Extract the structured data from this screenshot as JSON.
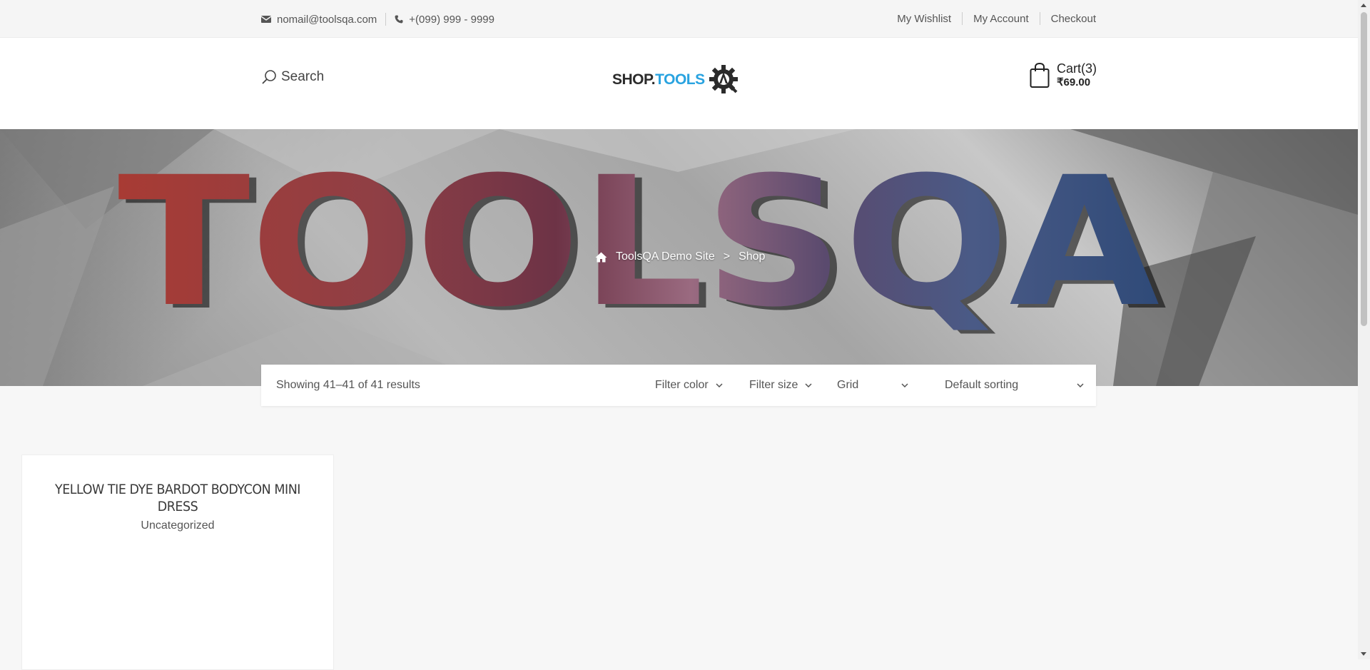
{
  "topbar": {
    "email": "nomail@toolsqa.com",
    "phone": "+(099) 999 - 9999",
    "links": [
      "My Wishlist",
      "My Account",
      "Checkout"
    ]
  },
  "header": {
    "search_label": "Search",
    "logo_shop": "SHOP.",
    "logo_tools": "TOOLS",
    "logo_badge": "QA",
    "cart_label": "Cart(3)",
    "cart_total": "₹69.00"
  },
  "hero": {
    "banner_text": "TOOLSQA",
    "breadcrumb_home": "ToolsQA Demo Site",
    "breadcrumb_sep": ">",
    "breadcrumb_current": "Shop"
  },
  "toolbar": {
    "result_count": "Showing 41–41 of 41 results",
    "filter_color": "Filter color",
    "filter_size": "Filter size",
    "view": "Grid",
    "sorting": "Default sorting"
  },
  "products": [
    {
      "name": "YELLOW TIE DYE BARDOT BODYCON MINI DRESS",
      "category": "Uncategorized"
    }
  ],
  "colors": {
    "accent": "#29a3e0",
    "background": "#f7f7f7"
  }
}
